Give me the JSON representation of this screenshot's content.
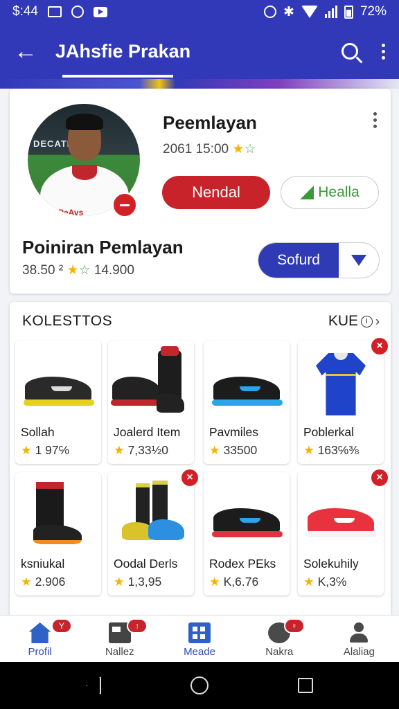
{
  "status_bar": {
    "time": "$:44",
    "battery": "72%"
  },
  "app_bar": {
    "title": "JAhsfie Prakan",
    "icons": [
      "back-arrow-icon",
      "search-icon",
      "more-vert-icon"
    ]
  },
  "profile": {
    "name": "Peemlayan",
    "meta": "2061 15:00",
    "rating_stars": "★☆",
    "primary_button": "Nendal",
    "secondary_button": "Healla",
    "subtitle": "Poiniran Pemlayan",
    "sub_meta_a": "38.50 ²",
    "sub_meta_b": "14.900",
    "split_button": "Sofurd",
    "avatar_banner": "DECATHLON",
    "avatar_sponsor": "PeAvs"
  },
  "collection": {
    "title": "KOLESTTOS",
    "more_label": "KUE",
    "items": [
      {
        "name": "Sollah",
        "rating": "1 97℅",
        "close": false
      },
      {
        "name": "Joalerd Item",
        "rating": "7,33½0",
        "close": false
      },
      {
        "name": "Pavmiles",
        "rating": "33500",
        "close": false
      },
      {
        "name": "Poblerkal",
        "rating": "163℅⅜",
        "close": true
      },
      {
        "name": "ksniukal",
        "rating": "2.906",
        "close": false
      },
      {
        "name": "Oodal Derls",
        "rating": "1,3,95",
        "close": true
      },
      {
        "name": "Rodex PEks",
        "rating": "K,6.76",
        "close": false
      },
      {
        "name": "Solekuhily",
        "rating": "K,3℅",
        "close": true
      }
    ]
  },
  "bottom_nav": [
    {
      "label": "Profil",
      "icon": "home-icon",
      "badge": "Y"
    },
    {
      "label": "Nallez",
      "icon": "grid-icon",
      "badge": "↑"
    },
    {
      "label": "Meade",
      "icon": "tiles-icon",
      "badge": ""
    },
    {
      "label": "Nakra",
      "icon": "chat-icon",
      "badge": "♀"
    },
    {
      "label": "Alaliag",
      "icon": "person-icon",
      "badge": ""
    }
  ],
  "colors": {
    "primary": "#3239b8",
    "accent_red": "#c8232b",
    "star": "#f4b400"
  }
}
